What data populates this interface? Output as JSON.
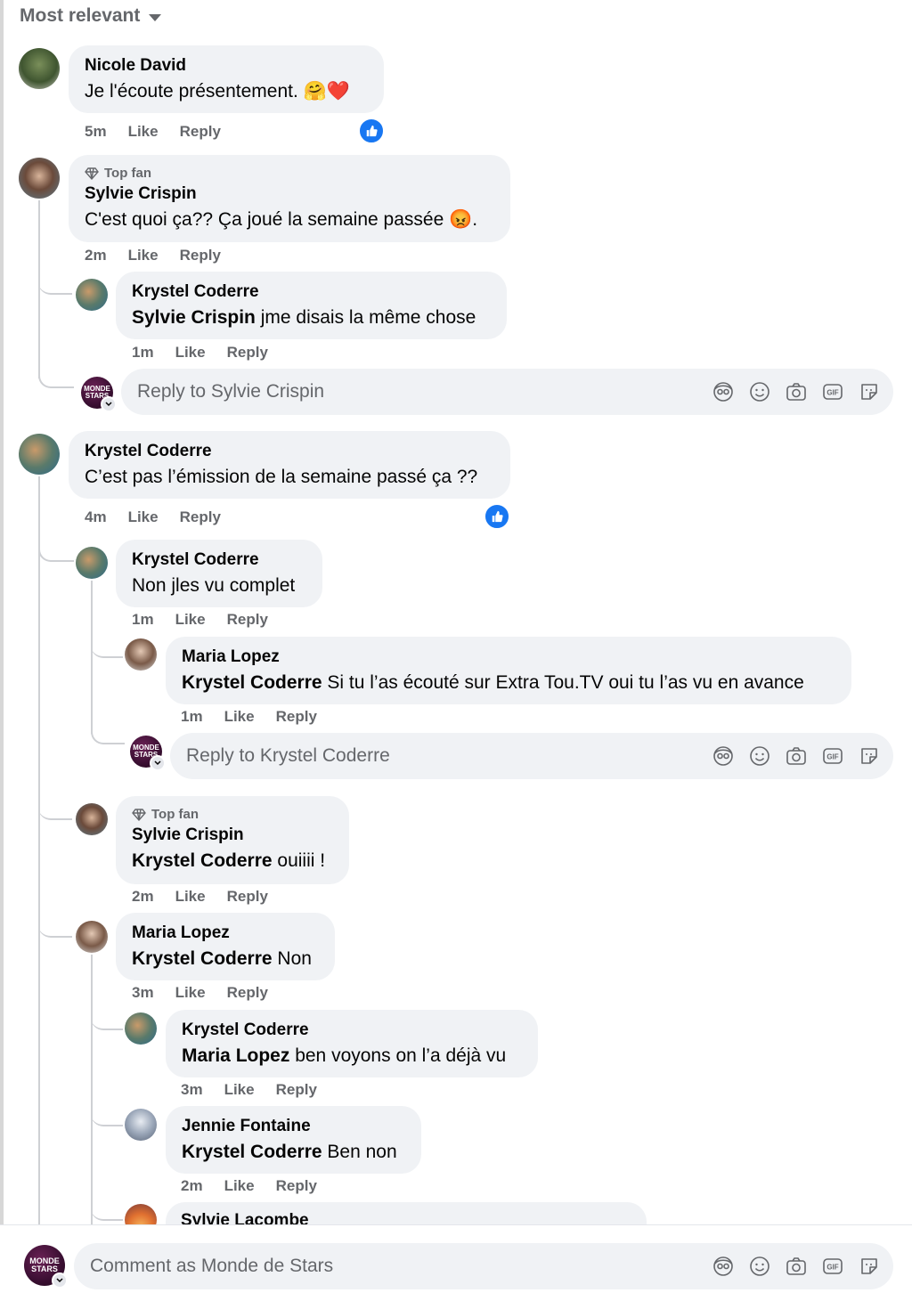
{
  "sort": {
    "label": "Most relevant"
  },
  "actions": {
    "like": "Like",
    "reply": "Reply"
  },
  "top_fan_label": "Top fan",
  "page_avatar_text": "MONDE STARS",
  "comments": [
    {
      "author": "Nicole David",
      "text": "Je l'écoute présentement. 🤗❤️",
      "time": "5m"
    },
    {
      "author": "Sylvie Crispin",
      "text": "C'est quoi ça?? Ça joué la semaine passée 😡.",
      "time": "2m",
      "reply": {
        "author": "Krystel Coderre",
        "mention": "Sylvie Crispin",
        "text": " jme disais la même chose",
        "time": "1m"
      },
      "input_placeholder": "Reply to Sylvie Crispin"
    },
    {
      "author": "Krystel Coderre",
      "text": "C’est pas l’émission de la semaine passé ça ??",
      "time": "4m",
      "replies": [
        {
          "author": "Krystel Coderre",
          "text": "Non jles vu complet",
          "time": "1m",
          "reply": {
            "author": "Maria Lopez",
            "mention": "Krystel Coderre",
            "text": " Si tu l’as écouté sur Extra Tou.TV oui tu l’as vu en avance",
            "time": "1m"
          },
          "input_placeholder": "Reply to Krystel Coderre"
        },
        {
          "author": "Sylvie Crispin",
          "mention": "Krystel Coderre",
          "text": " ouiiii !",
          "time": "2m"
        },
        {
          "author": "Maria Lopez",
          "mention": "Krystel Coderre",
          "text": " Non",
          "time": "3m",
          "replies": [
            {
              "author": "Krystel Coderre",
              "mention": "Maria Lopez",
              "text": " ben voyons on l’a déjà vu",
              "time": "3m"
            },
            {
              "author": "Jennie Fontaine",
              "mention": "Krystel Coderre",
              "text": " Ben non",
              "time": "2m"
            },
            {
              "author": "Sylvie Lacombe"
            }
          ]
        }
      ]
    }
  ],
  "composer": {
    "placeholder": "Comment as Monde de Stars"
  },
  "tool_icons": [
    "avatar-sticker-icon",
    "emoji-icon",
    "camera-icon",
    "gif-icon",
    "sticker-icon"
  ],
  "colors": {
    "bubble": "#f0f2f5",
    "meta_text": "#65676b",
    "like_blue": "#1877f2",
    "page_avatar": "#3a0f32"
  }
}
